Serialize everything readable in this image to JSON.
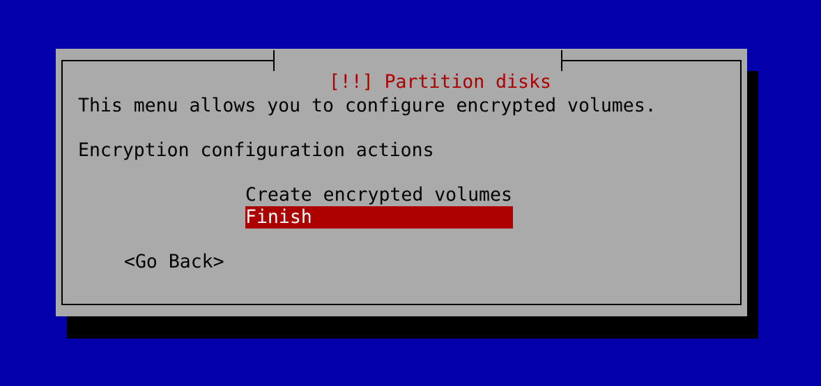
{
  "dialog": {
    "title": "[!!] Partition disks",
    "description": "This menu allows you to configure encrypted volumes.",
    "prompt": "Encryption configuration actions",
    "menu": [
      {
        "label": "Create encrypted volumes",
        "selected": false
      },
      {
        "label": "Finish",
        "selected": true
      }
    ],
    "buttons": {
      "go_back": "<Go Back>"
    }
  },
  "colors": {
    "background": "#0000aa",
    "dialog": "#aaaaaa",
    "title": "#aa0000",
    "selection": "#aa0000",
    "selection_text": "#ffffff",
    "shadow": "#000000"
  }
}
